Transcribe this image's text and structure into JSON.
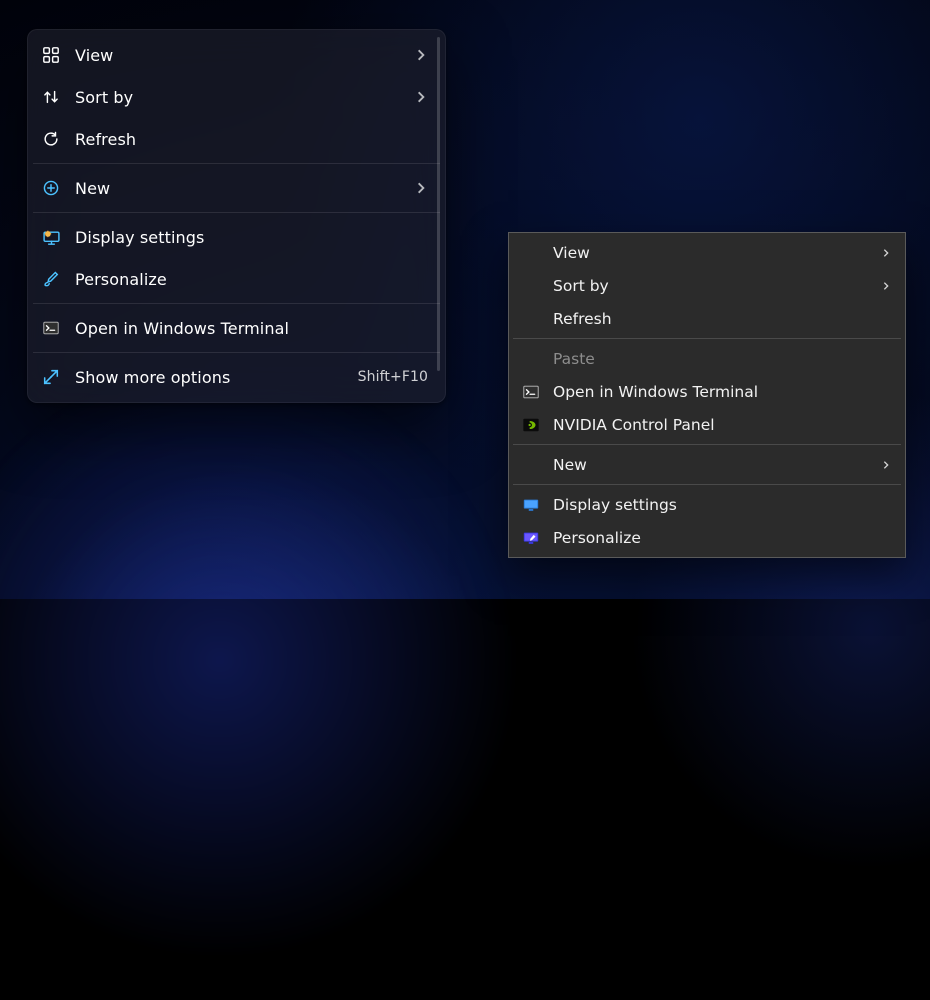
{
  "left_menu": {
    "items": [
      {
        "icon": "grid-icon",
        "label": "View",
        "submenu": true
      },
      {
        "icon": "sort-icon",
        "label": "Sort by",
        "submenu": true
      },
      {
        "icon": "refresh-icon",
        "label": "Refresh",
        "submenu": false
      }
    ],
    "items2": [
      {
        "icon": "add-circle-icon",
        "label": "New",
        "submenu": true
      }
    ],
    "items3": [
      {
        "icon": "display-gear-icon",
        "label": "Display settings",
        "submenu": false
      },
      {
        "icon": "brush-icon",
        "label": "Personalize",
        "submenu": false
      }
    ],
    "items4": [
      {
        "icon": "terminal-icon",
        "label": "Open in Windows Terminal",
        "submenu": false
      }
    ],
    "items5": [
      {
        "icon": "expand-icon",
        "label": "Show more options",
        "submenu": false,
        "shortcut": "Shift+F10"
      }
    ]
  },
  "right_menu": {
    "g1": [
      {
        "label": "View",
        "submenu": true
      },
      {
        "label": "Sort by",
        "submenu": true
      },
      {
        "label": "Refresh",
        "submenu": false
      }
    ],
    "g2": [
      {
        "label": "Paste",
        "disabled": true
      },
      {
        "icon": "terminal-icon",
        "label": "Open in Windows Terminal"
      },
      {
        "icon": "nvidia-icon",
        "label": "NVIDIA Control Panel"
      }
    ],
    "g3": [
      {
        "label": "New",
        "submenu": true
      }
    ],
    "g4": [
      {
        "icon": "monitor-blue-icon",
        "label": "Display settings"
      },
      {
        "icon": "monitor-purple-icon",
        "label": "Personalize"
      }
    ]
  }
}
